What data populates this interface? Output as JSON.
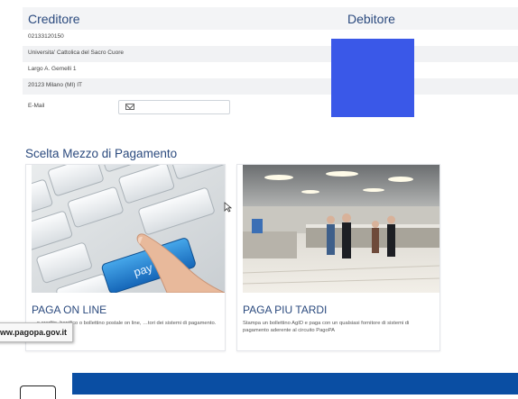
{
  "creditor": {
    "header": "Creditore",
    "fiscal_code": "02133120150",
    "name": "Universita' Cattolica del Sacro Cuore",
    "address": "Largo A. Gemelli 1",
    "city": "20123 Milano (MI) IT",
    "email_label": "E-Mail",
    "email_value": ""
  },
  "debtor": {
    "header": "Debitore"
  },
  "payment": {
    "section_title": "Scelta Mezzo di Pagamento",
    "online": {
      "title": "PAGA ON LINE",
      "description": "…o credito, bonifico o bollettino postale on line, …tori dei sistemi di pagamento.",
      "key_text": "pay"
    },
    "later": {
      "title": "PAGA PIU TARDI",
      "description": "Stampa un bollettino AgID e paga con un qualsiasi fornitore di sistemi di pagamento aderente al circuito PagoPA"
    }
  },
  "badge": "www.pagopa.gov.it",
  "colors": {
    "heading": "#2b4a7e",
    "redaction": "#3a58e8",
    "footer": "#0a4ea3"
  }
}
